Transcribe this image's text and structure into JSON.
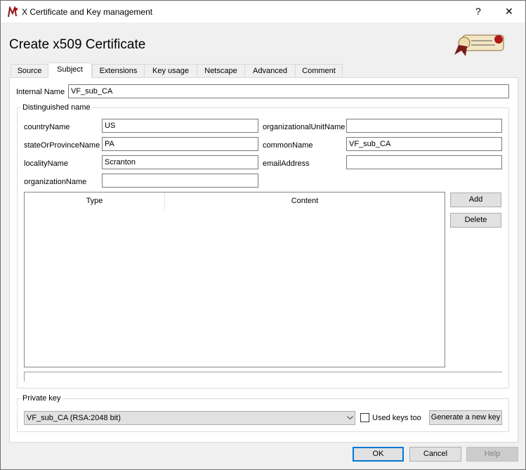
{
  "window": {
    "title": "X Certificate and Key management",
    "help": "?",
    "close": "✕"
  },
  "header": {
    "title": "Create x509 Certificate"
  },
  "tabs": [
    {
      "label": "Source"
    },
    {
      "label": "Subject",
      "selected": true
    },
    {
      "label": "Extensions"
    },
    {
      "label": "Key usage"
    },
    {
      "label": "Netscape"
    },
    {
      "label": "Advanced"
    },
    {
      "label": "Comment"
    }
  ],
  "internal_name": {
    "label": "Internal Name",
    "value": "VF_sub_CA"
  },
  "dn": {
    "title": "Distinguished name",
    "countryName": {
      "label": "countryName",
      "value": "US"
    },
    "stateOrProvinceName": {
      "label": "stateOrProvinceName",
      "value": "PA"
    },
    "localityName": {
      "label": "localityName",
      "value": "Scranton"
    },
    "organizationName": {
      "label": "organizationName",
      "value": ""
    },
    "organizationalUnitName": {
      "label": "organizationalUnitName",
      "value": ""
    },
    "commonName": {
      "label": "commonName",
      "value": "VF_sub_CA"
    },
    "emailAddress": {
      "label": "emailAddress",
      "value": ""
    },
    "table": {
      "columns": [
        "Type",
        "Content"
      ],
      "rows": []
    },
    "add": "Add",
    "delete": "Delete"
  },
  "private_key": {
    "title": "Private key",
    "selected": "VF_sub_CA (RSA:2048 bit)",
    "used_keys_label": "Used keys too",
    "used_keys_checked": false,
    "generate": "Generate a new key"
  },
  "footer": {
    "ok": "OK",
    "cancel": "Cancel",
    "help": "Help"
  },
  "colors": {
    "accent": "#0078d7",
    "logo_red": "#8b1a1a"
  }
}
